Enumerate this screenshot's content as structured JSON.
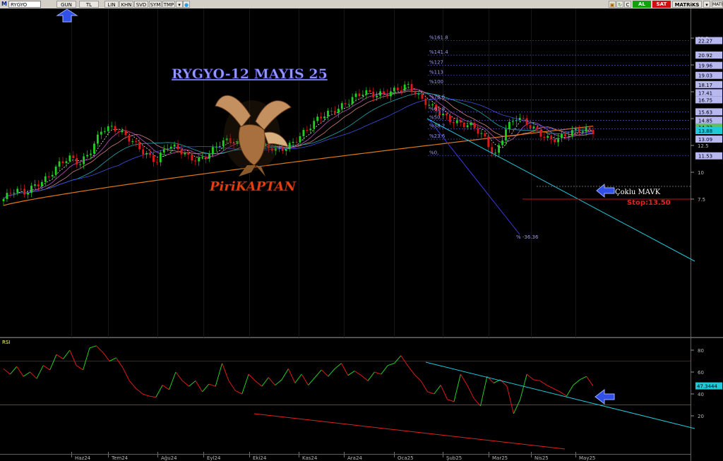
{
  "toolbar": {
    "app_letter": "M",
    "symbol": "RYGYO",
    "period": "GUN",
    "currency": "TL",
    "buttons": [
      "LIN",
      "KHN",
      "SVD",
      "SYM",
      "TMP"
    ],
    "right_buttons": [
      "C",
      "AL",
      "SAT",
      "MATRiKS",
      "MATRiKS"
    ],
    "icons": [
      "dropdown-arrow-icon",
      "twitter-icon",
      "settings-icon",
      "refresh-icon",
      "minimize-icon"
    ]
  },
  "annotations": {
    "title": "RYGYO-12 MAYIS 25",
    "brand": "PiriKAPTAN",
    "note": "Çoklu MAVK",
    "stop": "Stop:13.50"
  },
  "colors": {
    "price_up": "#22d022",
    "price_down": "#e01818",
    "ma200": "#e07818",
    "trendline": "#20c8d8",
    "fib_line": "#5c5cd8",
    "arrow": "#3050e8",
    "stop_line": "#c01010",
    "title": "#9696ff",
    "brand": "#e84010"
  },
  "chart_data": [
    {
      "type": "line",
      "title": "RYGYO",
      "y_scale": "linear",
      "ylim": [
        6.4,
        23
      ],
      "y_ticks": [
        "22.5",
        "20",
        "17.5",
        "15",
        "12.5",
        "10",
        "7.5"
      ],
      "x_ticks": [
        "Haz24",
        "Tem24",
        "Ağu24",
        "Eyl24",
        "Eki24",
        "Kas24",
        "Ara24",
        "Oca25",
        "Şub25",
        "Mar25",
        "Nis25",
        "May25"
      ],
      "price_close": [
        7.5,
        8.2,
        8.0,
        9.0,
        9.6,
        10.6,
        11.2,
        10.8,
        12.2,
        14.1,
        14.0,
        13.4,
        12.8,
        11.9,
        11.0,
        12.3,
        12.1,
        11.5,
        11.3,
        11.8,
        12.7,
        12.9,
        12.6,
        12.5,
        12.3,
        11.9,
        12.4,
        13.4,
        14.2,
        15.0,
        15.5,
        16.3,
        17.1,
        17.4,
        17.0,
        17.3,
        17.9,
        18.2,
        16.9,
        16.1,
        15.6,
        15.0,
        14.5,
        14.1,
        13.2,
        11.6,
        14.2,
        15.1,
        14.3,
        13.7,
        13.2,
        13.3,
        13.6,
        13.8,
        13.9
      ],
      "fibonacci": [
        {
          "level": "%161.8",
          "value": 22.27
        },
        {
          "level": "%141.4",
          "value": 20.92
        },
        {
          "level": "%127",
          "value": 19.96
        },
        {
          "level": "%113",
          "value": 19.03
        },
        {
          "level": "%100",
          "value": 18.17
        },
        {
          "level": "%78.6",
          "value": 16.75
        },
        {
          "level": "%61.8",
          "value": 15.63
        },
        {
          "level": "%50",
          "value": 14.85
        },
        {
          "level": "%38.2",
          "value": 14.05
        },
        {
          "level": "%23.6",
          "value": 13.09
        },
        {
          "level": "%0",
          "value": 11.53
        }
      ],
      "fib_labels_shown": [
        "%161.8",
        "%141.4",
        "%127",
        "%113",
        "%100",
        "%78.6",
        "%61.8",
        "%50,",
        "%38.2",
        "%23.6",
        "%0,"
      ],
      "price_boxes": [
        "22.27",
        "20.92",
        "19.96",
        "19.03",
        "18.17",
        "17.41",
        "16.75",
        "15.63",
        "14.85",
        "14.22",
        "13.88",
        "13.09",
        "11.53"
      ],
      "drawdown_label": "% -36.36",
      "ma200_start": 6.9,
      "ma200_end": 14.3,
      "stop_level": 13.5
    },
    {
      "type": "line",
      "title": "RSI",
      "ylim": [
        18,
        86
      ],
      "y_ticks": [
        "80",
        "60",
        "40",
        "20"
      ],
      "overbought": 70,
      "oversold": 30,
      "last_value_box": "47.3444",
      "values": [
        63,
        58,
        65,
        56,
        60,
        54,
        66,
        62,
        76,
        72,
        80,
        66,
        62,
        82,
        84,
        78,
        70,
        73,
        64,
        52,
        45,
        40,
        38,
        37,
        48,
        44,
        60,
        52,
        47,
        52,
        42,
        49,
        47,
        68,
        52,
        43,
        40,
        58,
        52,
        47,
        55,
        48,
        53,
        63,
        50,
        58,
        48,
        55,
        62,
        56,
        63,
        68,
        57,
        61,
        57,
        52,
        60,
        58,
        66,
        68,
        75,
        66,
        58,
        52,
        42,
        40,
        48,
        35,
        33,
        58,
        48,
        36,
        29,
        56,
        50,
        53,
        47,
        22,
        35,
        58,
        53,
        52,
        48,
        45,
        42,
        38,
        48,
        53,
        56,
        47.3
      ]
    }
  ]
}
